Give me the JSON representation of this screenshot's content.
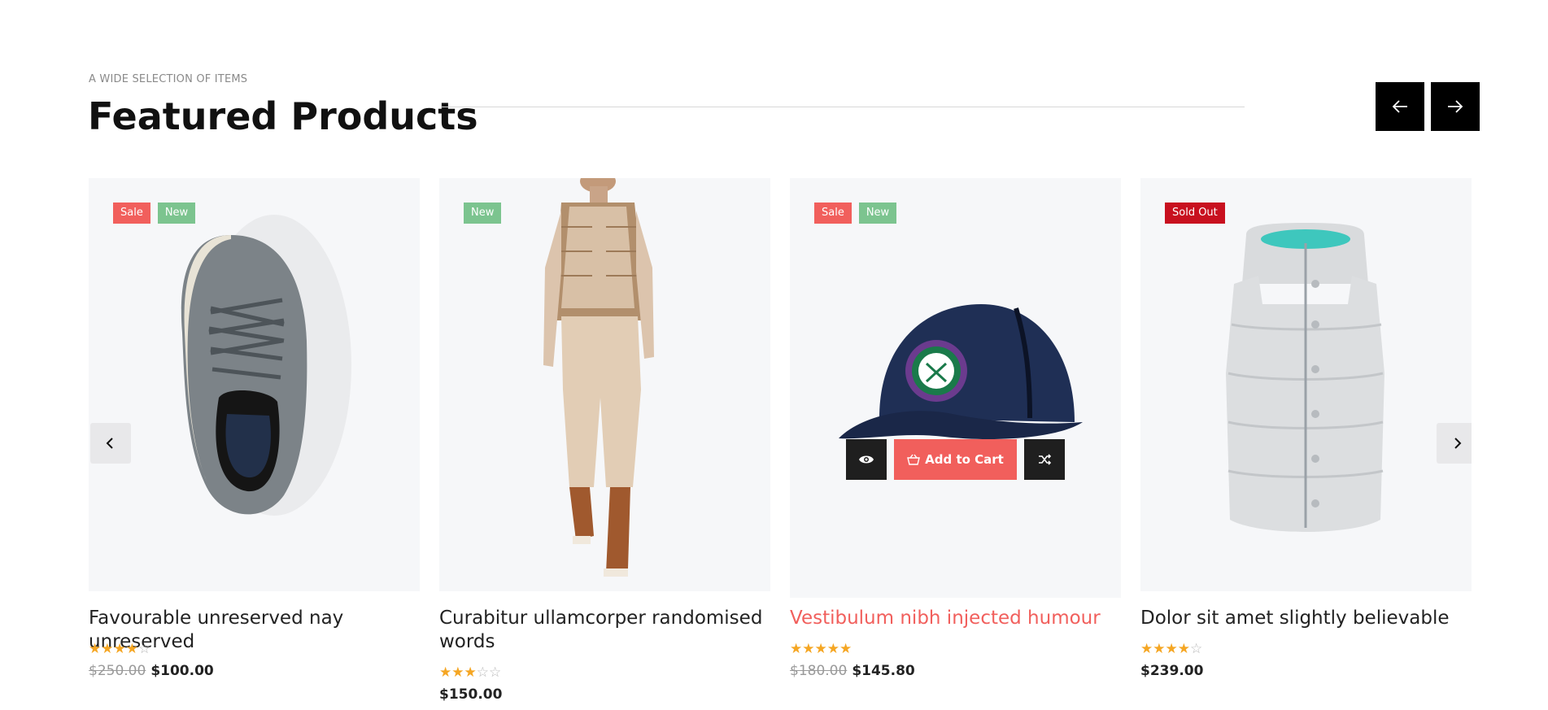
{
  "section": {
    "eyebrow": "A WIDE SELECTION OF ITEMS",
    "title": "Featured Products"
  },
  "accent_color": "#f15f5c",
  "products": [
    {
      "badges": [
        "Sale",
        "New"
      ],
      "title": "Favourable unreserved nay unreserved",
      "rating": 4,
      "stars_on": "★★★★",
      "stars_off": "☆",
      "old_price": "$250.00",
      "price": "$100.00",
      "image": "shoe"
    },
    {
      "badges": [
        "New"
      ],
      "title": "Curabitur ullamcorper randomised words",
      "rating": 3,
      "stars_on": "★★★",
      "stars_off": "☆☆",
      "old_price": "",
      "price": "$150.00",
      "image": "model-outfit"
    },
    {
      "badges": [
        "Sale",
        "New"
      ],
      "title": "Vestibulum nibh injected humour",
      "rating": 5,
      "stars_on": "★★★★★",
      "stars_off": "",
      "old_price": "$180.00",
      "price": "$145.80",
      "image": "cap",
      "add_to_cart_label": "Add to Cart"
    },
    {
      "badges": [
        "Sold Out"
      ],
      "title": "Dolor sit amet slightly believable",
      "rating": 4,
      "stars_on": "★★★★",
      "stars_off": "☆",
      "old_price": "",
      "price": "$239.00",
      "image": "puffer-vest"
    }
  ]
}
